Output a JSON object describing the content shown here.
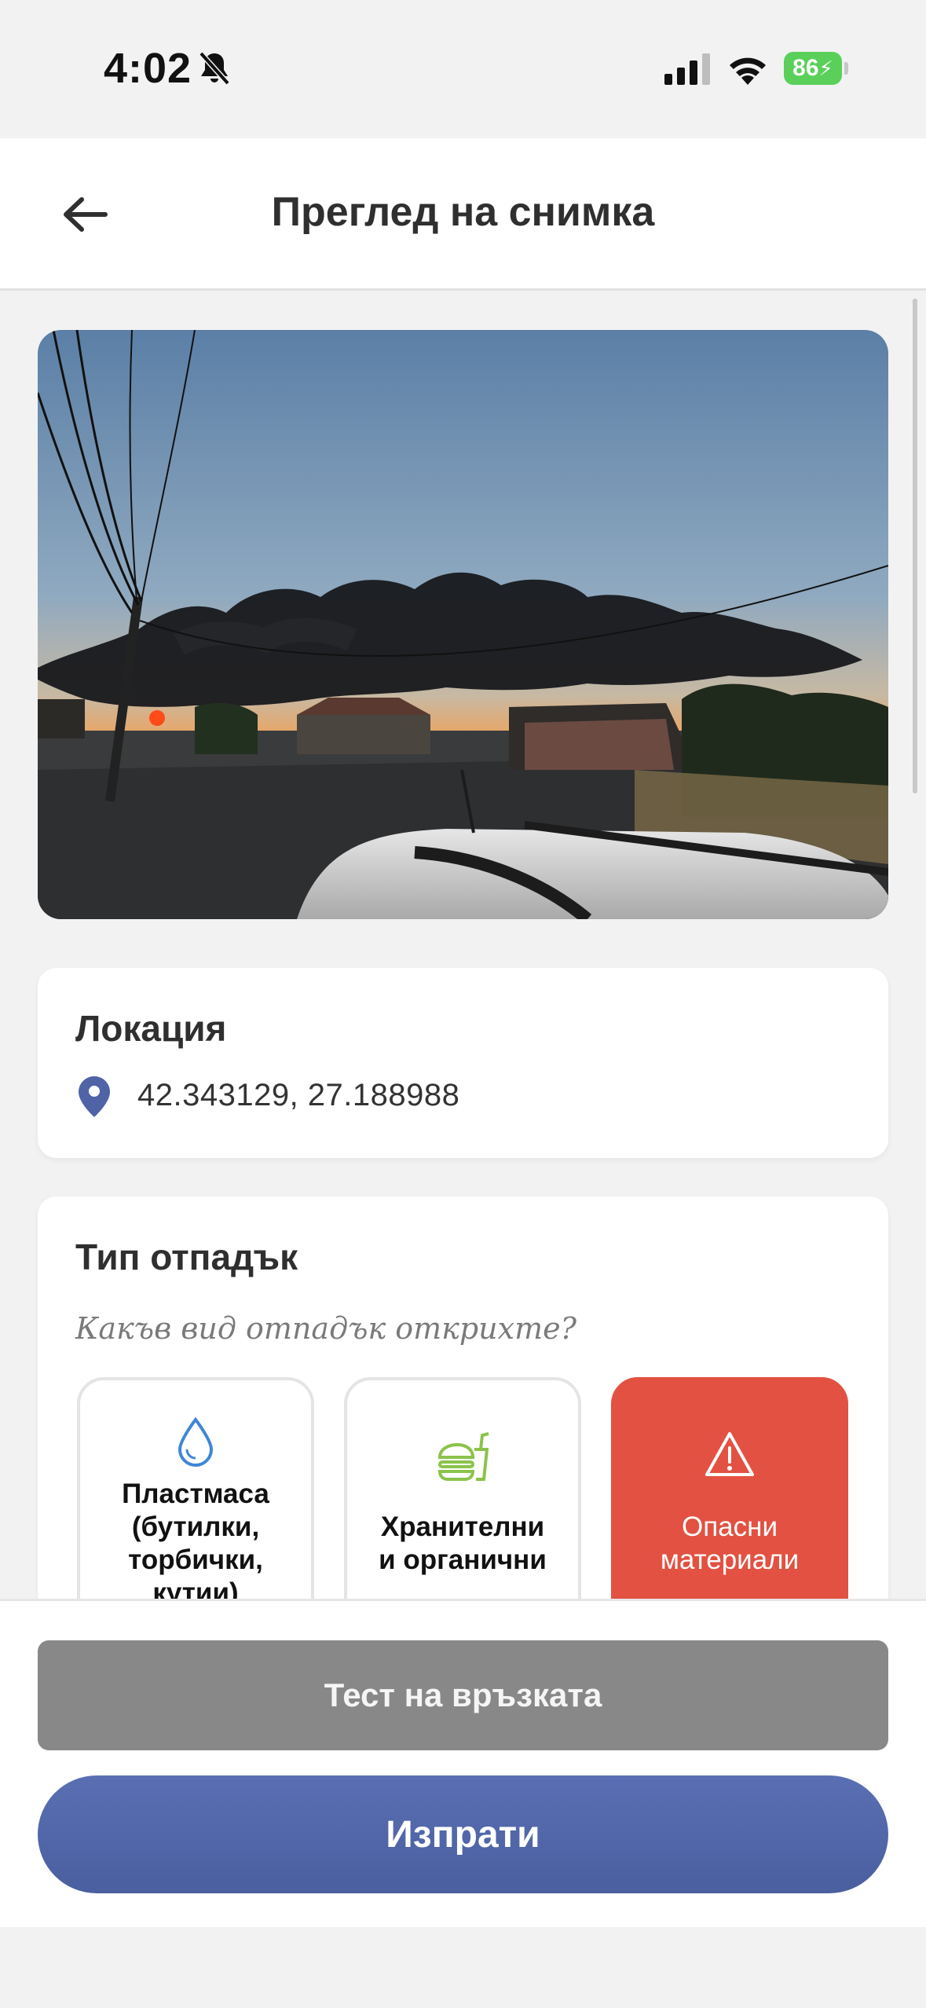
{
  "status_bar": {
    "time": "4:02",
    "battery": "86",
    "icons": [
      "bell-slash-icon",
      "signal-icon",
      "wifi-icon",
      "battery-charging-icon"
    ]
  },
  "header": {
    "title": "Преглед на снимка",
    "back_icon": "arrow-left-icon"
  },
  "photo": {
    "subject": "black smoke plume over houses at sunset"
  },
  "location": {
    "title": "Локация",
    "coordinates": "42.343129, 27.188988",
    "icon": "map-pin-icon"
  },
  "waste_type": {
    "title": "Тип отпадък",
    "question": "Какъв вид отпадък открихте?",
    "options": [
      {
        "label": "Пластмаса\n(бутилки,\nторбички,\nкутии)",
        "icon": "water-drop-icon",
        "selected": false
      },
      {
        "label": "Хранителни\nи органични",
        "icon": "fast-food-icon",
        "selected": false
      },
      {
        "label": "Опасни\nматериали",
        "icon": "warning-icon",
        "selected": true
      }
    ]
  },
  "actions": {
    "test_label": "Тест на връзката",
    "send_label": "Изпрати"
  },
  "colors": {
    "accent": "#4F63A6",
    "danger": "#E25141",
    "food_icon": "#8BC34A",
    "plastic_icon": "#3F86D6",
    "test_button": "#888888"
  }
}
